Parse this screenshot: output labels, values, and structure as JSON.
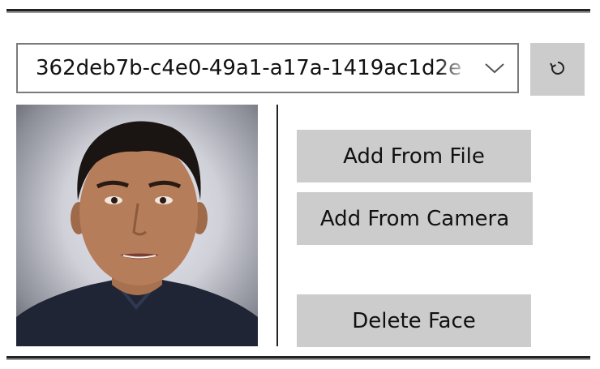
{
  "person_selector": {
    "selected_value": "362deb7b-c4e0-49a1-a17a-1419ac1d2e"
  },
  "icons": {
    "chevron": "chevron-down-icon",
    "refresh": "refresh-icon"
  },
  "actions": {
    "add_from_file": "Add From File",
    "add_from_camera": "Add From Camera",
    "delete_face": "Delete Face"
  },
  "colors": {
    "button_background": "#cccccc",
    "border": "#7a7a7a",
    "text": "#111111"
  }
}
